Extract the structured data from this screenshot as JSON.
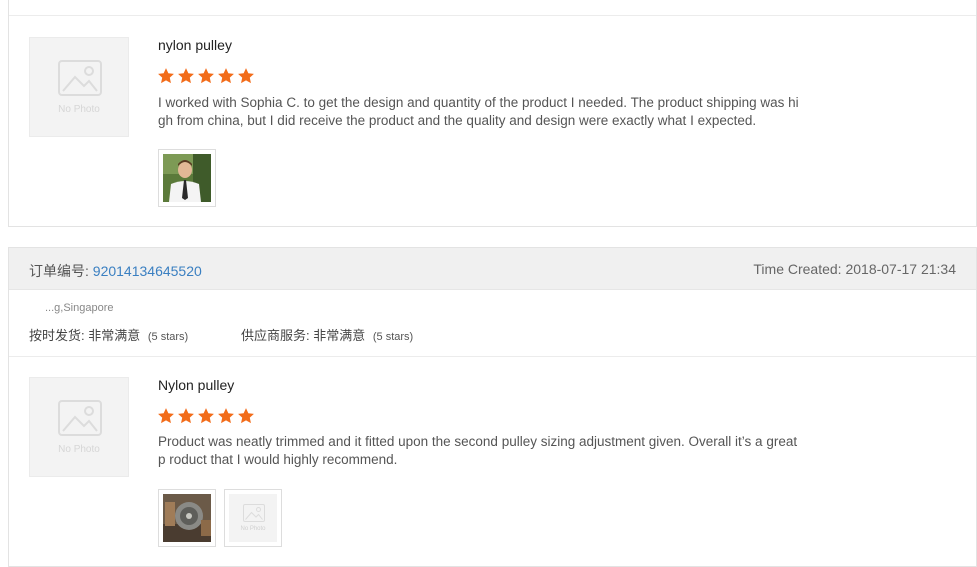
{
  "review1": {
    "thumb_text": "No Photo",
    "product": "nylon pulley",
    "rating": 5,
    "text": "I worked with Sophia C. to get the design and quantity of the product I needed. The product shipping was hi gh from china, but I did receive the product and the quality and design were exactly what I expected."
  },
  "order": {
    "label": "订单编号:",
    "number": "92014134645520",
    "time_created": "Time Created: 2018-07-17 21:34",
    "buyer_location": "...g,Singapore",
    "ontime_label": "按时发货: 非常满意",
    "ontime_stars": "(5 stars)",
    "service_label": "供应商服务: 非常满意",
    "service_stars": "(5 stars)"
  },
  "review2": {
    "thumb_text": "No Photo",
    "product": "Nylon pulley",
    "rating": 5,
    "text": "Product was neatly trimmed and it fitted upon the second pulley sizing adjustment given. Overall it’s a great p roduct that I would highly recommend.",
    "photo2_text": "No Photo"
  },
  "colors": {
    "star": "#f26c1a",
    "link": "#3a7fc1",
    "header_bg": "#f0f0f0"
  }
}
